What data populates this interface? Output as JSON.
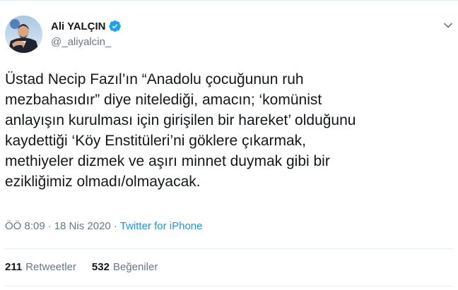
{
  "author": {
    "name": "Ali YALÇIN",
    "handle": "@_aliyalcin_"
  },
  "tweet": {
    "text": "Üstad Necip Fazıl’ın “Anadolu çocuğunun ruh\nmezbahasıdır” diye nitelediği, amacın; ‘komünist\nanlayışın kurulması için girişilen bir hareket’ olduğunu\nkaydettiği ‘Köy Enstitüleri’ni göklere çıkarmak,\nmethiyeler dizmek ve aşırı minnet duymak gibi bir\nezikliğimiz olmadı/olmayacak."
  },
  "meta": {
    "time": "ÖÖ 8:09",
    "separator1": "·",
    "date": "18 Nis 2020",
    "separator2": "·",
    "source": "Twitter for iPhone"
  },
  "stats": {
    "retweets_count": "211",
    "retweets_label": "Retweetler",
    "likes_count": "532",
    "likes_label": "Beğeniler"
  },
  "colors": {
    "verified": "#1da1f2",
    "link": "#1b95e0",
    "secondary_text": "#657786",
    "border": "#e6ecf0"
  },
  "icons": {
    "verified": "verified-badge-icon",
    "menu": "chevron-down-icon"
  }
}
